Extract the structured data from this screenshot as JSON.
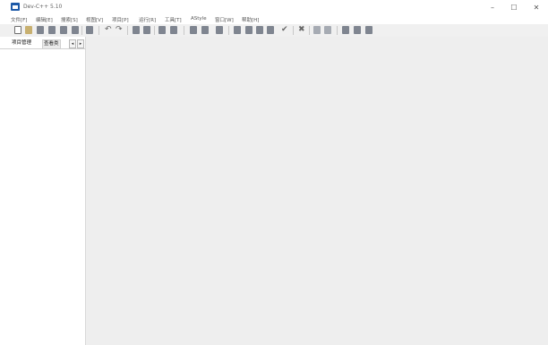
{
  "window": {
    "title": "Dev-C++ 5.10",
    "minimize": "–",
    "maximize": "☐",
    "close": "✕"
  },
  "menu": {
    "items": [
      {
        "label": "文件[F]"
      },
      {
        "label": "编辑[E]"
      },
      {
        "label": "搜索[S]"
      },
      {
        "label": "视图[V]"
      },
      {
        "label": "项目[P]"
      },
      {
        "label": "运行[R]"
      },
      {
        "label": "工具[T]"
      },
      {
        "label": "AStyle"
      },
      {
        "label": "窗口[W]"
      },
      {
        "label": "帮助[H]"
      }
    ]
  },
  "toolbar": {
    "undo": "↶",
    "redo": "↷",
    "check": "✔",
    "cross": "✖"
  },
  "left_panel": {
    "tab_project": "项目管理",
    "tab_class": "查看类",
    "scroll_left": "◂",
    "scroll_right": "▸"
  }
}
